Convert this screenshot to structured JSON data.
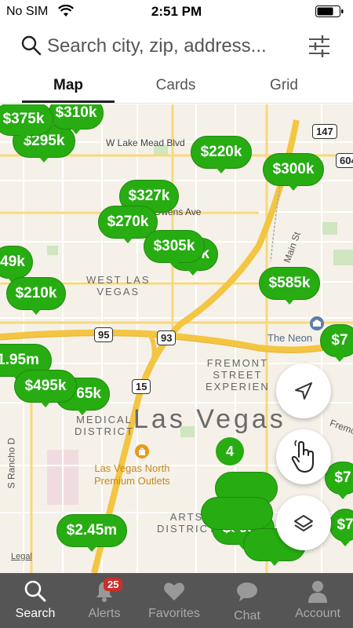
{
  "status_bar": {
    "carrier": "No SIM",
    "time": "2:51 PM"
  },
  "search": {
    "placeholder": "Search city, zip, address..."
  },
  "tabs": [
    {
      "label": "Map",
      "active": true
    },
    {
      "label": "Cards",
      "active": false
    },
    {
      "label": "Grid",
      "active": false
    }
  ],
  "map": {
    "labels": {
      "lake_mead": "W Lake Mead Blvd",
      "owens": "Owens Ave",
      "west_las_vegas": "WEST LAS\nVEGAS",
      "fremont": "FREMONT\nSTREET\nEXPERIEN",
      "medical": "MEDICAL\nDISTRICT",
      "city": "Las Vegas",
      "outlets": "Las Vegas North\nPremium Outlets",
      "arts": "ARTS\nDISTRICT",
      "rancho": "S Rancho D",
      "main_st": "Main St",
      "neon": "The Neon",
      "fremont_st": "Fremo"
    },
    "shields": [
      "147",
      "604",
      "95",
      "93",
      "15"
    ],
    "pins": [
      {
        "label": "$375k"
      },
      {
        "label": "$310k"
      },
      {
        "label": "$295k"
      },
      {
        "label": "$220k"
      },
      {
        "label": "$300k"
      },
      {
        "label": "$327k"
      },
      {
        "label": "$270k"
      },
      {
        "label": "$305k"
      },
      {
        "label": "49k"
      },
      {
        "label": "$210k"
      },
      {
        "label": "$585k"
      },
      {
        "label": "1.95m"
      },
      {
        "label": "$495k"
      },
      {
        "label": "65k"
      },
      {
        "label": "$599k"
      },
      {
        "label": "$2.45m"
      },
      {
        "label": "$7"
      },
      {
        "label": "$7"
      },
      {
        "label": "$7"
      }
    ],
    "cluster": "4",
    "legal": "Legal"
  },
  "colors": {
    "pin_green": "#27ac12",
    "nav_bg": "#555555",
    "badge_red": "#c9302c",
    "road_yellow": "#f4c542"
  },
  "bottom_nav": {
    "items": [
      {
        "label": "Search",
        "icon": "search-icon",
        "active": true
      },
      {
        "label": "Alerts",
        "icon": "bell-icon",
        "badge": "25"
      },
      {
        "label": "Favorites",
        "icon": "heart-icon"
      },
      {
        "label": "Chat",
        "icon": "chat-icon"
      },
      {
        "label": "Account",
        "icon": "person-icon"
      }
    ]
  }
}
